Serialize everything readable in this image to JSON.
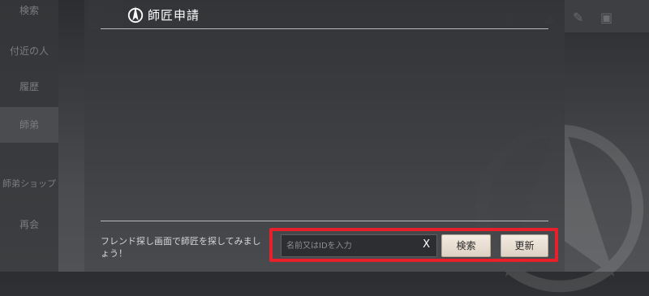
{
  "sidebar": {
    "items": [
      {
        "label": "検索"
      },
      {
        "label": "付近の人"
      },
      {
        "label": "履歴"
      },
      {
        "label": "師弟"
      },
      {
        "label": "師弟ショップ"
      },
      {
        "label": "再会"
      }
    ]
  },
  "modal": {
    "title": "師匠申請",
    "hint": "フレンド探し画面で師匠を探してみましょう！",
    "search": {
      "placeholder": "名前又はIDを入力",
      "clear_label": "X"
    },
    "search_button": "検索",
    "refresh_button": "更新"
  },
  "colors": {
    "highlight": "#e8202c",
    "button_bg": "#ece3d8"
  },
  "icons": [
    "star-emblem-icon",
    "mail-icon",
    "graduation-cap-icon",
    "edit-icon",
    "chat-icon"
  ]
}
